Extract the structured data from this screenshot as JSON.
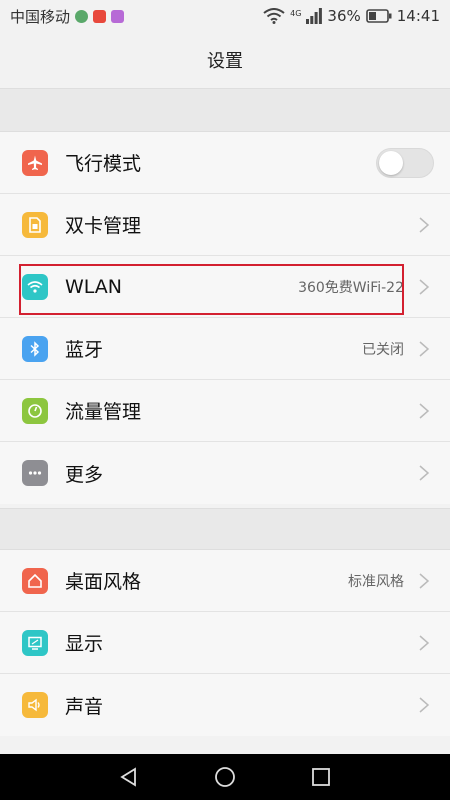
{
  "status_bar": {
    "carrier": "中国移动",
    "network": "4G",
    "battery": "36%",
    "time": "14:41"
  },
  "header": {
    "title": "设置"
  },
  "groups": [
    {
      "items": [
        {
          "label": "飞行模式",
          "icon": "airplane-icon",
          "icon_color": "#f0654d",
          "control": "toggle",
          "toggle_on": false
        },
        {
          "label": "双卡管理",
          "icon": "sim-card-icon",
          "icon_color": "#f6b93b"
        },
        {
          "label": "WLAN",
          "icon": "wifi-icon",
          "icon_color": "#2ec6c6",
          "value": "360免费WiFi-22",
          "highlighted": true
        },
        {
          "label": "蓝牙",
          "icon": "bluetooth-icon",
          "icon_color": "#4aa3f0",
          "value": "已关闭"
        },
        {
          "label": "流量管理",
          "icon": "data-usage-icon",
          "icon_color": "#8dc63f"
        },
        {
          "label": "更多",
          "icon": "more-icon",
          "icon_color": "#8e8e93"
        }
      ]
    },
    {
      "items": [
        {
          "label": "桌面风格",
          "icon": "home-icon",
          "icon_color": "#f0654d",
          "value": "标准风格"
        },
        {
          "label": "显示",
          "icon": "display-icon",
          "icon_color": "#2ec6c6"
        },
        {
          "label": "声音",
          "icon": "volume-icon",
          "icon_color": "#f6b93b"
        }
      ]
    }
  ],
  "highlight_color": "#d32030",
  "nav_bar": {
    "buttons": [
      "back-icon",
      "home-nav-icon",
      "recents-icon"
    ]
  }
}
